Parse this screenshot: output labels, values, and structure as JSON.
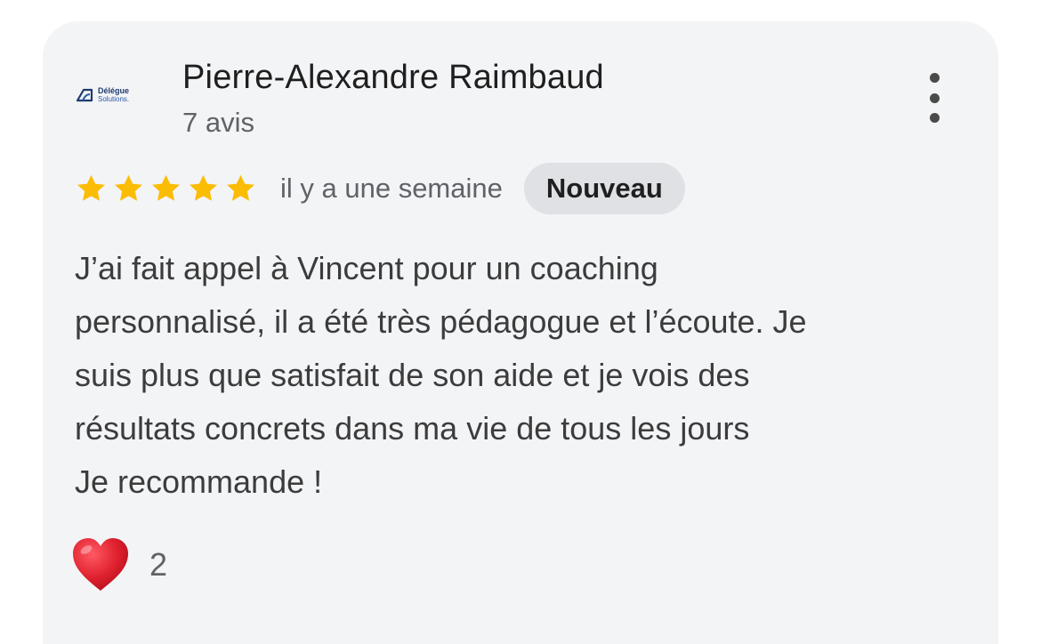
{
  "review": {
    "author": {
      "name": "Pierre-Alexandre Raimbaud",
      "review_count": "7 avis",
      "avatar_icon": "delegue-solutions-logo",
      "avatar_text_line1": "Délégue",
      "avatar_text_line2": "Solutions."
    },
    "rating": 5,
    "max_rating": 5,
    "time_ago": "il y a une semaine",
    "badge": "Nouveau",
    "text_lines": [
      "J’ai fait appel à Vincent pour un coaching",
      "personnalisé, il a été très pédagogue et l’écoute. Je",
      "suis plus que satisfait de son aide et je vois des",
      "résultats concrets dans ma vie de tous les jours",
      "Je recommande !"
    ],
    "reaction": {
      "icon": "heart-icon",
      "count": "2"
    },
    "more_icon": "more-vert-icon"
  },
  "colors": {
    "card_background": "#f3f4f6",
    "star": "#fbbc04",
    "heart": "#e0212f",
    "badge_background": "#dfe1e5"
  }
}
